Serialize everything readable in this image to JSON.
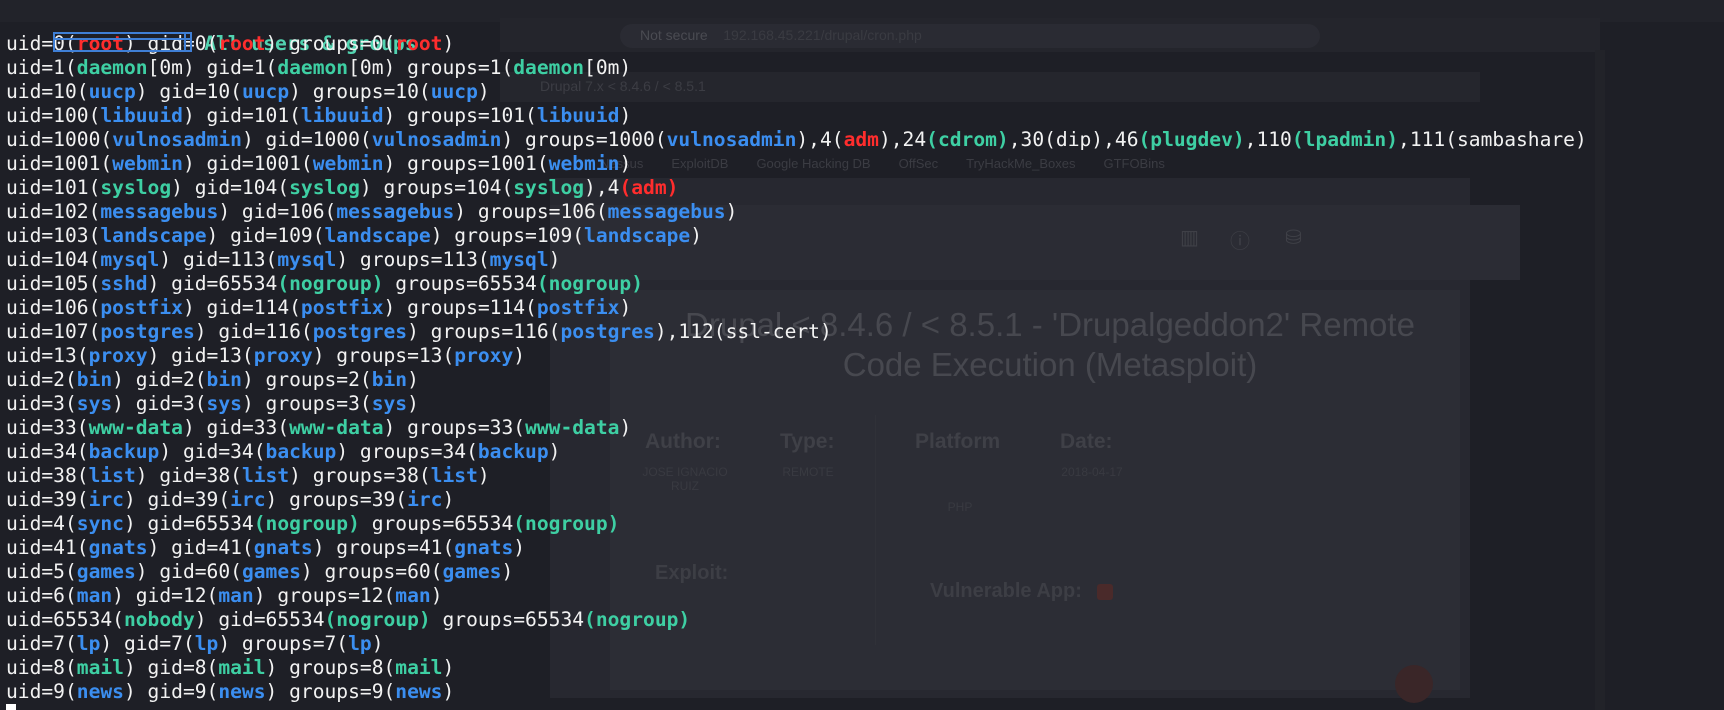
{
  "background_browser": {
    "url": "192.168.45.221/drupal/cron.php",
    "security_label": "Not secure",
    "tab_title": "Drupal 7.x < 8.4.6 / < 8.5.1",
    "bookmarks": [
      "Nessus",
      "ExploitDB",
      "Google Hacking DB",
      "OffSec",
      "TryHackMe_Boxes",
      "GTFOBins"
    ],
    "exploit_title": "Drupal < 8.4.6 / < 8.5.1 - 'Drupalgeddon2' Remote Code Execution (Metasploit)",
    "author_label": "Author:",
    "author_value": "JOSE IGNACIO RUIZ",
    "type_label": "Type:",
    "type_value": "REMOTE",
    "platform_label": "Platform",
    "platform_value": "PHP",
    "date_label": "Date:",
    "date_value": "2018-04-17",
    "exploit_label": "Exploit:",
    "vulnerable_label": "Vulnerable App:"
  },
  "terminal": {
    "header_title": "All users & groups",
    "lines": [
      [
        [
          "uid=0(",
          "w"
        ],
        [
          "root",
          "r"
        ],
        [
          ") gid=0(",
          "w"
        ],
        [
          "root",
          "r"
        ],
        [
          ") groups=0(",
          "w"
        ],
        [
          "root",
          "r"
        ],
        [
          ")",
          "w"
        ]
      ],
      [
        [
          "uid=1(",
          "w"
        ],
        [
          "daemon",
          "c"
        ],
        [
          "[0m) gid=1(",
          "w"
        ],
        [
          "daemon",
          "c"
        ],
        [
          "[0m) groups=1(",
          "w"
        ],
        [
          "daemon",
          "c"
        ],
        [
          "[0m)",
          "w"
        ]
      ],
      [
        [
          "uid=10(",
          "w"
        ],
        [
          "uucp",
          "b"
        ],
        [
          ") gid=10(",
          "w"
        ],
        [
          "uucp",
          "b"
        ],
        [
          ") groups=10(",
          "w"
        ],
        [
          "uucp",
          "b"
        ],
        [
          ")",
          "w"
        ]
      ],
      [
        [
          "uid=100(",
          "w"
        ],
        [
          "libuuid",
          "b"
        ],
        [
          ") gid=101(",
          "w"
        ],
        [
          "libuuid",
          "b"
        ],
        [
          ") groups=101(",
          "w"
        ],
        [
          "libuuid",
          "b"
        ],
        [
          ")",
          "w"
        ]
      ],
      [
        [
          "uid=1000(",
          "w"
        ],
        [
          "vulnosadmin",
          "b"
        ],
        [
          ") gid=1000(",
          "w"
        ],
        [
          "vulnosadmin",
          "b"
        ],
        [
          ") groups=1000(",
          "w"
        ],
        [
          "vulnosadmin",
          "b"
        ],
        [
          "),4(",
          "w"
        ],
        [
          "adm",
          "r"
        ],
        [
          "),24",
          "w"
        ],
        [
          "(cdrom)",
          "c"
        ],
        [
          ",30(dip),46",
          "w"
        ],
        [
          "(plugdev)",
          "c"
        ],
        [
          ",110",
          "w"
        ],
        [
          "(lpadmin)",
          "c"
        ],
        [
          ",111(sambashare)",
          "w"
        ]
      ],
      [
        [
          "uid=1001(",
          "w"
        ],
        [
          "webmin",
          "b"
        ],
        [
          ") gid=1001(",
          "w"
        ],
        [
          "webmin",
          "b"
        ],
        [
          ") groups=1001(",
          "w"
        ],
        [
          "webmin",
          "b"
        ],
        [
          ")",
          "w"
        ]
      ],
      [
        [
          "uid=101(",
          "w"
        ],
        [
          "syslog",
          "c"
        ],
        [
          ") gid=104(",
          "w"
        ],
        [
          "syslog",
          "c"
        ],
        [
          ") groups=104(",
          "w"
        ],
        [
          "syslog",
          "c"
        ],
        [
          "),4",
          "w"
        ],
        [
          "(adm)",
          "r"
        ]
      ],
      [
        [
          "uid=102(",
          "w"
        ],
        [
          "messagebus",
          "b"
        ],
        [
          ") gid=106(",
          "w"
        ],
        [
          "messagebus",
          "b"
        ],
        [
          ") groups=106(",
          "w"
        ],
        [
          "messagebus",
          "b"
        ],
        [
          ")",
          "w"
        ]
      ],
      [
        [
          "uid=103(",
          "w"
        ],
        [
          "landscape",
          "b"
        ],
        [
          ") gid=109(",
          "w"
        ],
        [
          "landscape",
          "b"
        ],
        [
          ") groups=109(",
          "w"
        ],
        [
          "landscape",
          "b"
        ],
        [
          ")",
          "w"
        ]
      ],
      [
        [
          "uid=104(",
          "w"
        ],
        [
          "mysql",
          "b"
        ],
        [
          ") gid=113(",
          "w"
        ],
        [
          "mysql",
          "b"
        ],
        [
          ") groups=113(",
          "w"
        ],
        [
          "mysql",
          "b"
        ],
        [
          ")",
          "w"
        ]
      ],
      [
        [
          "uid=105(",
          "w"
        ],
        [
          "sshd",
          "b"
        ],
        [
          ") gid=65534",
          "w"
        ],
        [
          "(nogroup)",
          "c"
        ],
        [
          " groups=65534",
          "w"
        ],
        [
          "(nogroup)",
          "c"
        ]
      ],
      [
        [
          "uid=106(",
          "w"
        ],
        [
          "postfix",
          "b"
        ],
        [
          ") gid=114(",
          "w"
        ],
        [
          "postfix",
          "b"
        ],
        [
          ") groups=114(",
          "w"
        ],
        [
          "postfix",
          "b"
        ],
        [
          ")",
          "w"
        ]
      ],
      [
        [
          "uid=107(",
          "w"
        ],
        [
          "postgres",
          "b"
        ],
        [
          ") gid=116(",
          "w"
        ],
        [
          "postgres",
          "b"
        ],
        [
          ") groups=116(",
          "w"
        ],
        [
          "postgres",
          "b"
        ],
        [
          "),112(ssl-cert)",
          "w"
        ]
      ],
      [
        [
          "uid=13(",
          "w"
        ],
        [
          "proxy",
          "b"
        ],
        [
          ") gid=13(",
          "w"
        ],
        [
          "proxy",
          "b"
        ],
        [
          ") groups=13(",
          "w"
        ],
        [
          "proxy",
          "b"
        ],
        [
          ")",
          "w"
        ]
      ],
      [
        [
          "uid=2(",
          "w"
        ],
        [
          "bin",
          "b"
        ],
        [
          ") gid=2(",
          "w"
        ],
        [
          "bin",
          "b"
        ],
        [
          ") groups=2(",
          "w"
        ],
        [
          "bin",
          "b"
        ],
        [
          ")",
          "w"
        ]
      ],
      [
        [
          "uid=3(",
          "w"
        ],
        [
          "sys",
          "b"
        ],
        [
          ") gid=3(",
          "w"
        ],
        [
          "sys",
          "b"
        ],
        [
          ") groups=3(",
          "w"
        ],
        [
          "sys",
          "b"
        ],
        [
          ")",
          "w"
        ]
      ],
      [
        [
          "uid=33(",
          "w"
        ],
        [
          "www-data",
          "c"
        ],
        [
          ") gid=33(",
          "w"
        ],
        [
          "www-data",
          "c"
        ],
        [
          ") groups=33(",
          "w"
        ],
        [
          "www-data",
          "c"
        ],
        [
          ")",
          "w"
        ]
      ],
      [
        [
          "uid=34(",
          "w"
        ],
        [
          "backup",
          "b"
        ],
        [
          ") gid=34(",
          "w"
        ],
        [
          "backup",
          "b"
        ],
        [
          ") groups=34(",
          "w"
        ],
        [
          "backup",
          "b"
        ],
        [
          ")",
          "w"
        ]
      ],
      [
        [
          "uid=38(",
          "w"
        ],
        [
          "list",
          "b"
        ],
        [
          ") gid=38(",
          "w"
        ],
        [
          "list",
          "b"
        ],
        [
          ") groups=38(",
          "w"
        ],
        [
          "list",
          "b"
        ],
        [
          ")",
          "w"
        ]
      ],
      [
        [
          "uid=39(",
          "w"
        ],
        [
          "irc",
          "b"
        ],
        [
          ") gid=39(",
          "w"
        ],
        [
          "irc",
          "b"
        ],
        [
          ") groups=39(",
          "w"
        ],
        [
          "irc",
          "b"
        ],
        [
          ")",
          "w"
        ]
      ],
      [
        [
          "uid=4(",
          "w"
        ],
        [
          "sync",
          "b"
        ],
        [
          ") gid=65534",
          "w"
        ],
        [
          "(nogroup)",
          "c"
        ],
        [
          " groups=65534",
          "w"
        ],
        [
          "(nogroup)",
          "c"
        ]
      ],
      [
        [
          "uid=41(",
          "w"
        ],
        [
          "gnats",
          "b"
        ],
        [
          ") gid=41(",
          "w"
        ],
        [
          "gnats",
          "b"
        ],
        [
          ") groups=41(",
          "w"
        ],
        [
          "gnats",
          "b"
        ],
        [
          ")",
          "w"
        ]
      ],
      [
        [
          "uid=5(",
          "w"
        ],
        [
          "games",
          "b"
        ],
        [
          ") gid=60(",
          "w"
        ],
        [
          "games",
          "b"
        ],
        [
          ") groups=60(",
          "w"
        ],
        [
          "games",
          "b"
        ],
        [
          ")",
          "w"
        ]
      ],
      [
        [
          "uid=6(",
          "w"
        ],
        [
          "man",
          "b"
        ],
        [
          ") gid=12(",
          "w"
        ],
        [
          "man",
          "b"
        ],
        [
          ") groups=12(",
          "w"
        ],
        [
          "man",
          "b"
        ],
        [
          ")",
          "w"
        ]
      ],
      [
        [
          "uid=65534(",
          "w"
        ],
        [
          "nobody",
          "c"
        ],
        [
          ") gid=65534",
          "w"
        ],
        [
          "(nogroup)",
          "c"
        ],
        [
          " groups=65534",
          "w"
        ],
        [
          "(nogroup)",
          "c"
        ]
      ],
      [
        [
          "uid=7(",
          "w"
        ],
        [
          "lp",
          "b"
        ],
        [
          ") gid=7(",
          "w"
        ],
        [
          "lp",
          "b"
        ],
        [
          ") groups=7(",
          "w"
        ],
        [
          "lp",
          "b"
        ],
        [
          ")",
          "w"
        ]
      ],
      [
        [
          "uid=8(",
          "w"
        ],
        [
          "mail",
          "c"
        ],
        [
          ") gid=8(",
          "w"
        ],
        [
          "mail",
          "c"
        ],
        [
          ") groups=8(",
          "w"
        ],
        [
          "mail",
          "c"
        ],
        [
          ")",
          "w"
        ]
      ],
      [
        [
          "uid=9(",
          "w"
        ],
        [
          "news",
          "b"
        ],
        [
          ") gid=9(",
          "w"
        ],
        [
          "news",
          "b"
        ],
        [
          ") groups=9(",
          "w"
        ],
        [
          "news",
          "b"
        ],
        [
          ")",
          "w"
        ]
      ]
    ]
  },
  "colors": {
    "background": "#1e1f26",
    "text": "#f2f2f2",
    "root_red": "#ff2d2d",
    "user_blue": "#3b8ef0",
    "user_cyan": "#3ecfa3",
    "header_cyan": "#52d3b0",
    "box_blue": "#3f7fd6"
  }
}
